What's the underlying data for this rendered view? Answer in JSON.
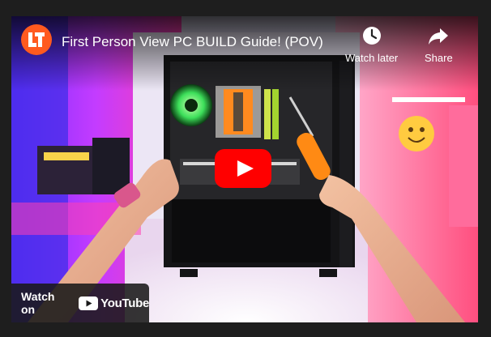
{
  "video": {
    "title": "First Person View PC BUILD Guide! (POV)"
  },
  "actions": {
    "watch_later_label": "Watch later",
    "share_label": "Share"
  },
  "footer": {
    "watch_on_label": "Watch on",
    "brand_label": "YouTube"
  },
  "icons": {
    "channel": "channel-avatar-icon",
    "watch_later": "clock-icon",
    "share": "share-arrow-icon",
    "play": "play-icon",
    "brand": "youtube-logo-icon"
  },
  "colors": {
    "play_red": "#ff0000",
    "channel_orange": "#ff5a1f",
    "page_bg": "#1e1e1e"
  }
}
